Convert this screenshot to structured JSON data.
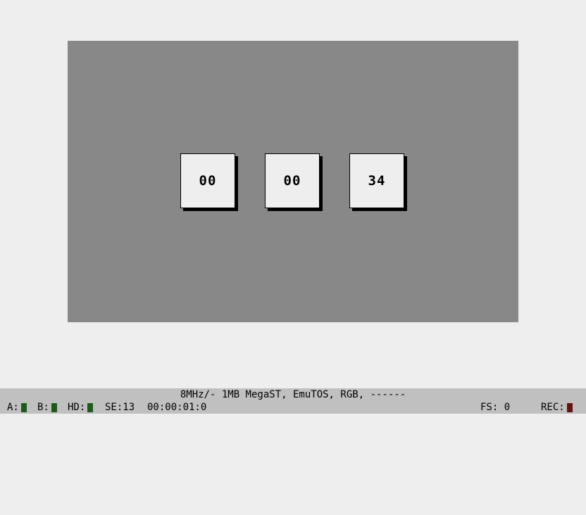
{
  "counters": [
    {
      "value": "00"
    },
    {
      "value": "00"
    },
    {
      "value": "34"
    }
  ],
  "statusbar": {
    "machine_info": "8MHz/- 1MB MegaST, EmuTOS, RGB, ------",
    "drive_a_label": "A:",
    "drive_b_label": "B:",
    "hd_label": "HD:",
    "se_label": "SE:13",
    "timecode": "00:00:01:0",
    "fs_label": "FS: 0",
    "rec_label": "REC:"
  },
  "colors": {
    "screen_bg": "#888888",
    "window_bg": "#eeeeee",
    "statusbar_bg": "#c0c0c0",
    "led_off_green": "#1e5a1e",
    "led_rec": "#6b1010"
  }
}
